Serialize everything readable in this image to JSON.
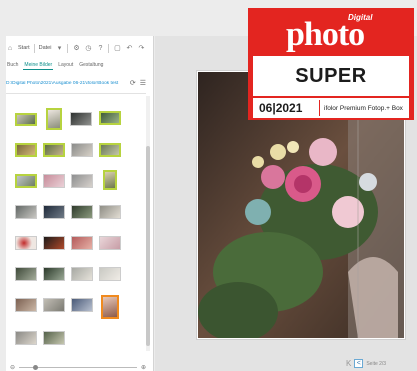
{
  "toolbar": {
    "start_label": "Start",
    "file_label": "Datei"
  },
  "tabs": [
    {
      "label": "Buch",
      "active": false
    },
    {
      "label": "Meine Bilder",
      "active": true
    },
    {
      "label": "Layout",
      "active": false
    },
    {
      "label": "Gestaltung",
      "active": false
    }
  ],
  "folder_path": "D:\\Digital Photo\\2021\\Ausgabe 06-21\\ifolor\\Book test",
  "badge": {
    "brand_small": "Digital",
    "brand": "photo",
    "rating": "SUPER",
    "issue": "06|2021",
    "product": "ifolor Premium Fotop.+ Box"
  },
  "navigation": {
    "prev_key": "K",
    "prev_label": "<",
    "page_indicator": "Seite 2/3"
  },
  "colors": {
    "accent": "#0e8f8b",
    "badge_red": "#e32520",
    "selected_border": "#b7d33f",
    "highlight_border": "#f08a1e",
    "link_blue": "#1a8fd0"
  }
}
